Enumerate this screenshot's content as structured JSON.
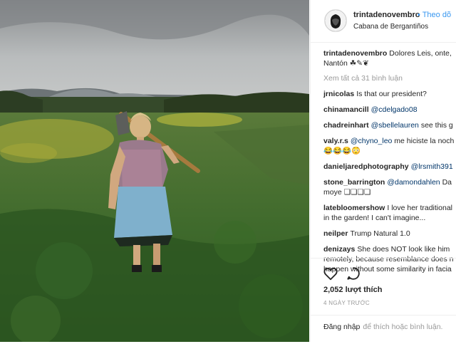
{
  "post": {
    "username": "trintadenovembro",
    "follow_label": "• Theo dõ",
    "location": "Cabana de Bergantiños",
    "caption_user": "trintadenovembro",
    "caption_line1": "Dolores Leis, onte,",
    "caption_line2": "Nantón ☘✎❦",
    "view_all": "Xem tất cả 31 bình luận"
  },
  "comments": [
    {
      "user": "jrnicolas",
      "mention": "",
      "text": "Is that our president?"
    },
    {
      "user": "chinamancill",
      "mention": "@cdelgado08",
      "text": ""
    },
    {
      "user": "chadreinhart",
      "mention": "@sbellelauren",
      "text": "see this g"
    },
    {
      "user": "valy.r.s",
      "mention": "@chyno_leo",
      "text": "me hiciste la noch",
      "text2": "😂😂😂😳"
    },
    {
      "user": "danieljaredphotography",
      "mention": "@lrsmith391",
      "text": ""
    },
    {
      "user": "stone_barrington",
      "mention": "@damondahlen",
      "text": "Da",
      "text2": "moye ❏❏❏❏"
    },
    {
      "user": "latebloomershow",
      "mention": "",
      "text": "I love her traditional",
      "text2": "in the garden! I can't imagine..."
    },
    {
      "user": "neilper",
      "mention": "",
      "text": "Trump Natural 1.0"
    },
    {
      "user": "denizays",
      "mention": "",
      "text": "She does NOT look like him",
      "text2": "remotely, because resemblance does n",
      "text3": "happen without some similarity in facia"
    }
  ],
  "actions": {
    "likes": "2,052 lượt thích",
    "time": "4 NGÀY TRƯỚC",
    "like_icon": "heart-icon",
    "comment_icon": "comment-icon"
  },
  "login": {
    "link": "Đăng nhập",
    "text": "để thích hoặc bình luận."
  }
}
